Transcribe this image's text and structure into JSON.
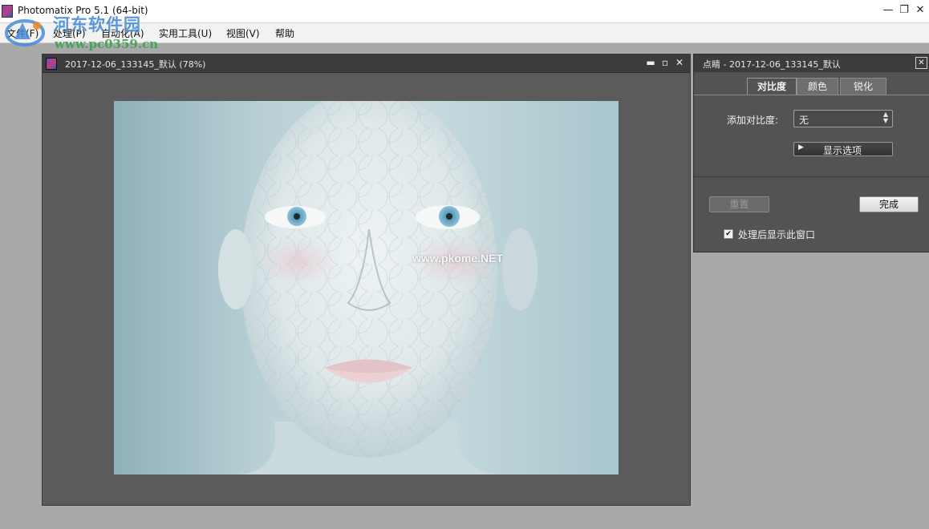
{
  "app": {
    "title": "Photomatix Pro 5.1 (64-bit)",
    "window_controls": {
      "minimize": "—",
      "restore": "❐",
      "close": "✕"
    }
  },
  "menu": {
    "items": [
      "文件(F)",
      "处理(P)",
      "自动化(A)",
      "实用工具(U)",
      "视图(V)",
      "帮助"
    ]
  },
  "watermark": {
    "name": "河东软件园",
    "url": "www.pc0359.cn"
  },
  "document": {
    "title": "2017-12-06_133145_默认 (78%)",
    "controls": {
      "minimize": "▬",
      "maximize": "▫",
      "close": "✕"
    },
    "photo_watermark": "www.pkome.NET"
  },
  "panel": {
    "title": "点睛 - 2017-12-06_133145_默认",
    "close": "✕",
    "tabs": [
      {
        "label": "对比度",
        "active": true
      },
      {
        "label": "颜色",
        "active": false
      },
      {
        "label": "锐化",
        "active": false
      }
    ],
    "contrast_label": "添加对比度:",
    "contrast_value": "无",
    "select_arrows": "▲\n▼",
    "show_options": "显示选项",
    "show_options_arrow": "▶",
    "reset": "重置",
    "done": "完成",
    "show_window_checked": true,
    "show_window_check_mark": "✔",
    "show_window_label": "处理后显示此窗口"
  },
  "colors": {
    "workspace": "#a9a9a9",
    "window_dark": "#5b5b5b",
    "panel": "#535353",
    "titlebar_dark": "#3c3c3c"
  }
}
